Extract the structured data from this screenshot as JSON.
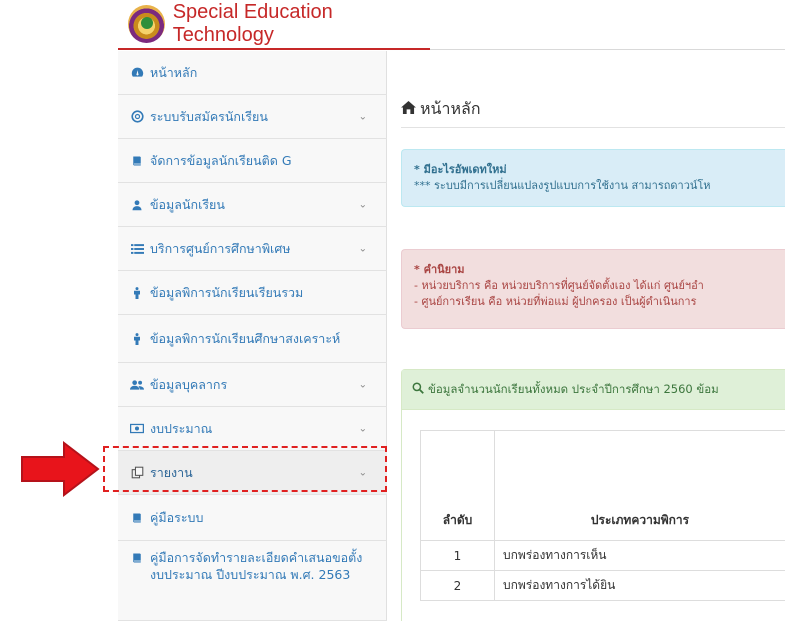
{
  "header": {
    "brand": "Special Education Technology"
  },
  "sidebar": {
    "items": [
      {
        "label": "หน้าหลัก",
        "icon": "dashboard-icon",
        "chevron": false
      },
      {
        "label": "ระบบรับสมัครนักเรียน",
        "icon": "life-ring-icon",
        "chevron": true
      },
      {
        "label": "จัดการข้อมูลนักเรียนติด G",
        "icon": "book-icon",
        "chevron": false
      },
      {
        "label": "ข้อมูลนักเรียน",
        "icon": "user-icon",
        "chevron": true
      },
      {
        "label": "บริการศูนย์การศึกษาพิเศษ",
        "icon": "list-icon",
        "chevron": true
      },
      {
        "label": "ข้อมูลพิการนักเรียนเรียนรวม",
        "icon": "person-icon",
        "chevron": false
      },
      {
        "label": "ข้อมูลพิการนักเรียนศึกษาสงเคราะห์",
        "icon": "person-icon",
        "chevron": false
      },
      {
        "label": "ข้อมูลบุคลากร",
        "icon": "users-icon",
        "chevron": true
      },
      {
        "label": "งบประมาณ",
        "icon": "money-icon",
        "chevron": true
      },
      {
        "label": "รายงาน",
        "icon": "copy-icon",
        "chevron": true
      },
      {
        "label": "คู่มือระบบ",
        "icon": "book-icon",
        "chevron": false
      },
      {
        "label": "คู่มือการจัดทำรายละเอียดคำเสนอขอตั้งงบประมาณ ปีงบประมาณ พ.ศ. 2563",
        "icon": "book-icon",
        "chevron": false
      }
    ]
  },
  "main": {
    "title": "หน้าหลัก",
    "alert_info": {
      "heading": "* มีอะไรอัพเดทใหม่",
      "text": "*** ระบบมีการเปลี่ยนแปลงรูปแบบการใช้งาน สามารถดาวน์โห"
    },
    "alert_danger": {
      "heading": "* คำนิยาม",
      "line1": "- หน่วยบริการ คือ หน่วยบริการที่ศูนย์จัดตั้งเอง ได้แก่ ศูนย์ฯอำ",
      "line2": "- ศูนย์การเรียน คือ หน่วยที่พ่อแม่ ผู้ปกครอง เป็นผู้ดำเนินการ"
    },
    "panel": {
      "heading": "ข้อมูลจำนวนนักเรียนทั้งหมด ประจำปีการศึกษา 2560 ข้อม",
      "table": {
        "headers": [
          "ลำดับ",
          "ประเภทความพิการ"
        ],
        "rows": [
          [
            "1",
            "บกพร่องทางการเห็น"
          ],
          [
            "2",
            "บกพร่องทางการได้ยิน"
          ]
        ]
      }
    }
  }
}
